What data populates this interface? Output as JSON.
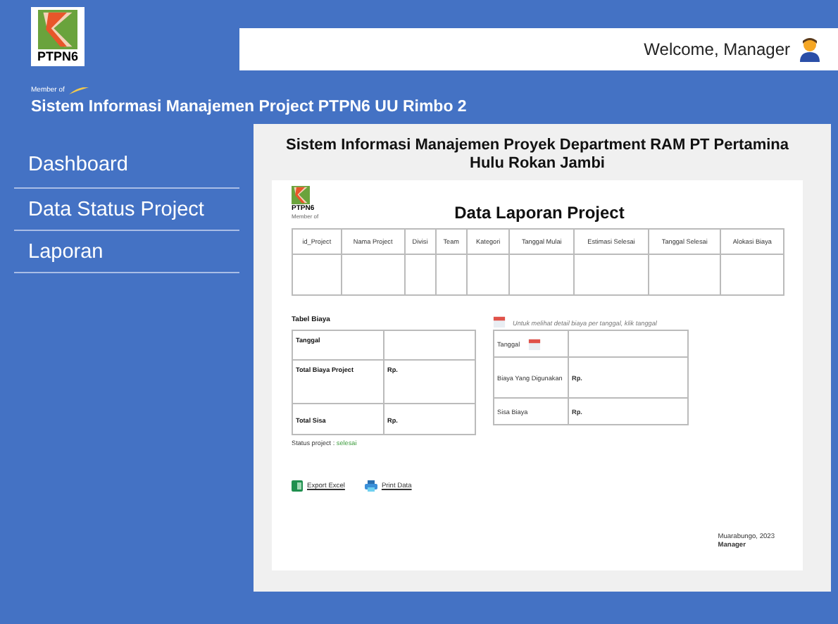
{
  "header": {
    "logo_text": "PTPN6",
    "logo_tagline": "Member of",
    "title": "Sistem Informasi Manajemen Project PTPN6 UU Rimbo 2",
    "welcome": "Welcome, Manager"
  },
  "sidebar": {
    "items": [
      {
        "label": "Dashboard",
        "selected": false
      },
      {
        "label": "Data Status Project",
        "selected": false
      },
      {
        "label": "Laporan",
        "selected": false
      }
    ]
  },
  "report": {
    "heading": "Sistem Informasi Manajemen Proyek Department RAM PT Pertamina Hulu Rokan Jambi",
    "logo_text": "PTPN6",
    "logo_tagline": "Member of",
    "title": "Data Laporan Project",
    "table": {
      "columns": [
        "id_Project",
        "Nama Project",
        "Divisi",
        "Team",
        "Kategori",
        "Tanggal Mulai",
        "Estimasi Selesai",
        "Tanggal Selesai",
        "Alokasi Biaya"
      ]
    },
    "cost_label": "Tabel Biaya",
    "hint": "Untuk melihat detail biaya per tanggal, klik tanggal",
    "cost_table": [
      {
        "label": "Tanggal"
      },
      {
        "label": "Total Biaya Project",
        "value": "Rp."
      },
      {
        "label": "Total Sisa",
        "value": "Rp."
      }
    ],
    "daily_table": [
      {
        "label": "Tanggal",
        "calendar": true
      },
      {
        "label": "Biaya Yang Digunakan",
        "value": "Rp."
      },
      {
        "label": "Sisa Biaya",
        "value": "Rp."
      }
    ],
    "status_label": "Status project :",
    "status": "selesai",
    "actions": [
      {
        "kind": "excel",
        "label": "Export Excel"
      },
      {
        "kind": "print",
        "label": "Print Data"
      }
    ],
    "place_date": "Muarabungo, 2023",
    "signer": "Manager"
  }
}
